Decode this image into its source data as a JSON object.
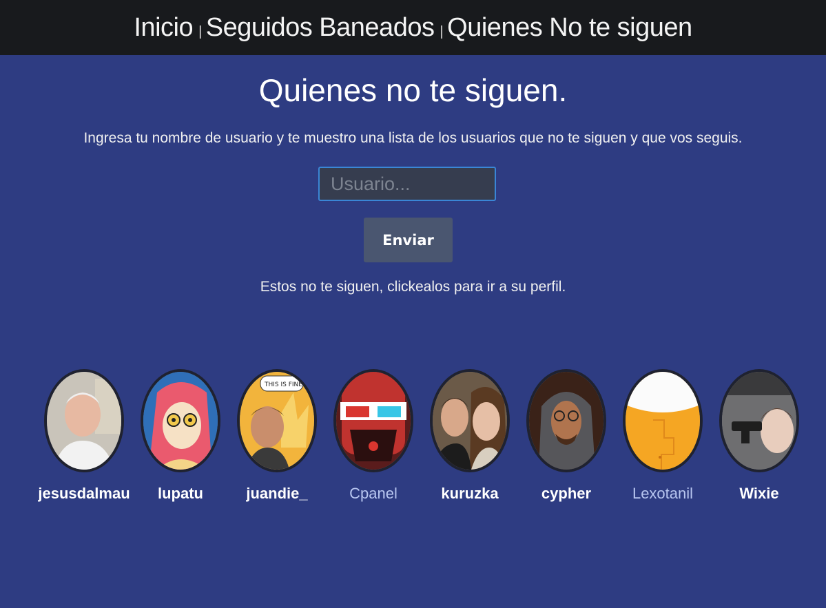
{
  "nav": {
    "inicio": "Inicio",
    "separator": "|",
    "seguidos_baneados": "Seguidos Baneados",
    "quienes_no_te_siguen": "Quienes No te siguen"
  },
  "main": {
    "title": "Quienes no te siguen.",
    "subtitle": "Ingresa tu nombre de usuario y te muestro una lista de los usuarios que no te siguen y que vos seguis.",
    "input_placeholder": "Usuario...",
    "input_value": "",
    "submit_label": "Enviar",
    "hint": "Estos no te siguen, clickealos para ir a su perfil."
  },
  "users": [
    {
      "name": "jesusdalmau",
      "visited": false,
      "avatar": "photo-older-man"
    },
    {
      "name": "lupatu",
      "visited": false,
      "avatar": "cartoon-pink-hair-girl"
    },
    {
      "name": "juandie_",
      "visited": false,
      "avatar": "this-is-fine-meme"
    },
    {
      "name": "Cpanel",
      "visited": true,
      "avatar": "red-face-3d-glasses"
    },
    {
      "name": "kuruzka",
      "visited": false,
      "avatar": "photo-couple"
    },
    {
      "name": "cypher",
      "visited": false,
      "avatar": "photo-hooded-man-glasses"
    },
    {
      "name": "Lexotanil",
      "visited": true,
      "avatar": "yellow-cartoon-shape"
    },
    {
      "name": "Wixie",
      "visited": false,
      "avatar": "meme-gun-girl"
    }
  ],
  "colors": {
    "background": "#2e3c82",
    "navbar": "#181a1d",
    "button": "#4a5670",
    "input_border": "#3a86d6",
    "visited_link": "#b8c6f0"
  }
}
